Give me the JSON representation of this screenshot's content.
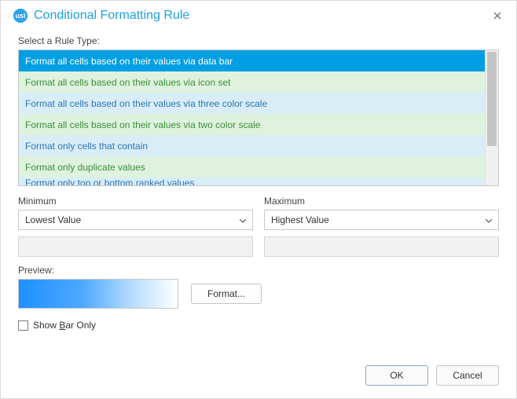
{
  "window": {
    "title": "Conditional Formatting Rule"
  },
  "rule_type_label": "Select a Rule Type:",
  "rule_items": [
    "Format all cells based on their values via data bar",
    "Format all cells based on their values via icon set",
    "Format all cells based on their values via three color scale",
    "Format all cells based on their values via two color scale",
    "Format only cells that contain",
    "Format only duplicate values",
    "Format only top or bottom ranked values"
  ],
  "min_label": "Minimum",
  "max_label": "Maximum",
  "min_value": "Lowest Value",
  "max_value": "Highest Value",
  "preview_label": "Preview:",
  "format_btn": "Format...",
  "show_bar_only_pre": "Show ",
  "show_bar_only_u": "B",
  "show_bar_only_post": "ar Only",
  "ok": "OK",
  "cancel": "Cancel"
}
